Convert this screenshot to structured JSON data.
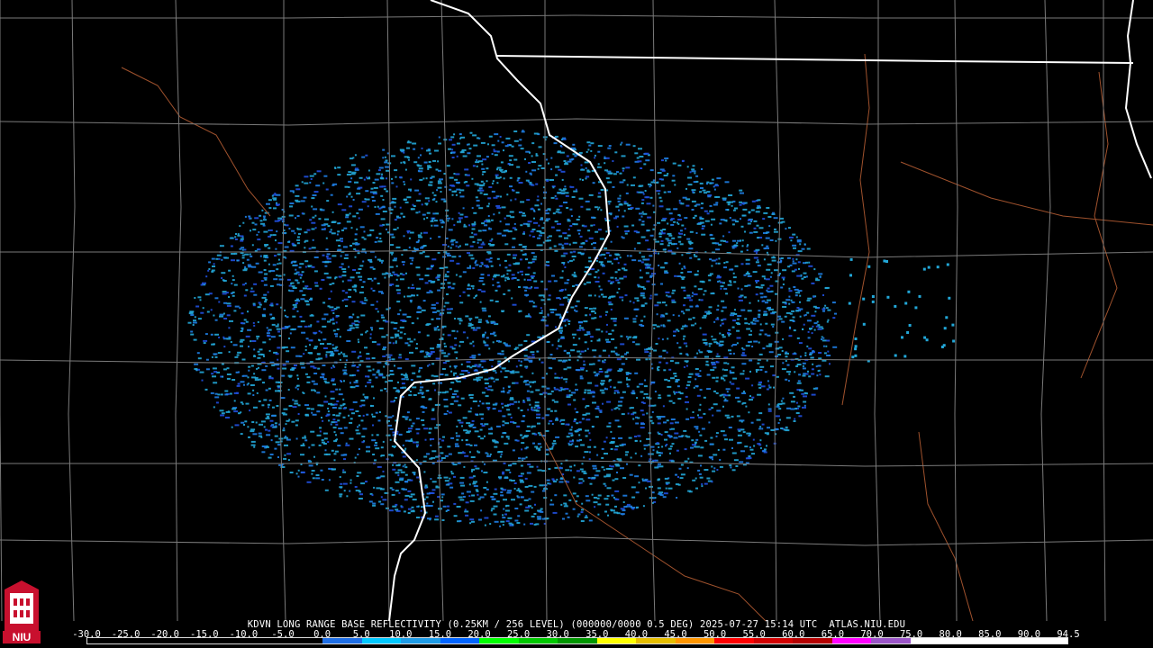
{
  "product": {
    "caption": "KDVN LONG RANGE BASE REFLECTIVITY (0.25KM / 256 LEVEL) (000000/0000 0.5 DEG) 2025-07-27 15:14 UTC  ATLAS.NIU.EDU"
  },
  "scale": {
    "ticks": [
      "-30.0",
      "-25.0",
      "-20.0",
      "-15.0",
      "-10.0",
      "-5.0",
      "0.0",
      "5.0",
      "10.0",
      "15.0",
      "20.0",
      "25.0",
      "30.0",
      "35.0",
      "40.0",
      "45.0",
      "50.0",
      "55.0",
      "60.0",
      "65.0",
      "70.0",
      "75.0",
      "80.0",
      "85.0",
      "90.0",
      "94.5"
    ],
    "colors": [
      "#000000",
      "#000000",
      "#000000",
      "#000000",
      "#000000",
      "#000000",
      "#1e6ee6",
      "#00c8ff",
      "#1e9be6",
      "#0064ff",
      "#00ff00",
      "#00c800",
      "#009600",
      "#ffff00",
      "#e6be00",
      "#ff9600",
      "#ff0000",
      "#d20000",
      "#b40000",
      "#ff00ff",
      "#9b55c8",
      "#ffffff",
      "#ffffff",
      "#ffffff",
      "#ffffff"
    ]
  },
  "logo": {
    "text": "NIU",
    "colors": {
      "primary": "#c8102e",
      "secondary": "#ffffff"
    }
  },
  "map_colors": {
    "state_border": "#ffffff",
    "county_border": "#8a8a8a",
    "river": "#a0522d",
    "echo_light": "#22a7d8",
    "echo_medium": "#1e7ee6",
    "echo_dark": "#2050e0"
  }
}
